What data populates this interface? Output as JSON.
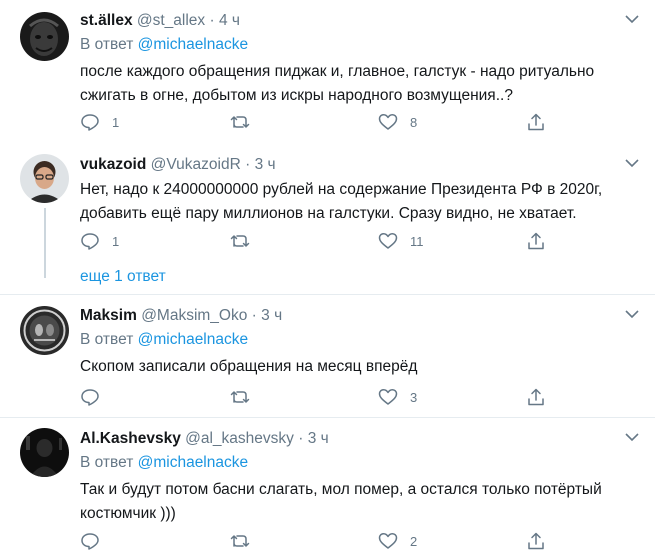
{
  "reply_prefix": "В ответ",
  "tweets": [
    {
      "name": "st.ällex",
      "handle": "@st_allex",
      "time": "4 ч",
      "reply_to": "@michaelnacke",
      "text": "после каждого обращения пиджак и, главное, галстук - надо ритуально сжигать в огне, добытом из искры народного возмущения..?",
      "replies": "1",
      "retweets": "",
      "likes": "8"
    },
    {
      "name": "vukazoid",
      "handle": "@VukazoidR",
      "time": "3 ч",
      "reply_to": "",
      "text": "Нет, надо к 24000000000 рублей на содержание Президента РФ в 2020г, добавить ещё пару миллионов на галстуки. Сразу видно, не хватает.",
      "replies": "1",
      "retweets": "",
      "likes": "11"
    },
    {
      "name": "Maksim",
      "handle": "@Maksim_Oko",
      "time": "3 ч",
      "reply_to": "@michaelnacke",
      "text": "Скопом записали обращения на месяц вперёд",
      "replies": "",
      "retweets": "",
      "likes": "3"
    },
    {
      "name": "Al.Kashevsky",
      "handle": "@al_kashevsky",
      "time": "3 ч",
      "reply_to": "@michaelnacke",
      "text": "Так и будут потом басни слагать, мол помер, а остался только потёртый костюмчик )))",
      "replies": "",
      "retweets": "",
      "likes": "2"
    }
  ],
  "more_replies": "еще 1 ответ",
  "icons": {
    "reply": "reply-icon",
    "retweet": "retweet-icon",
    "like": "like-icon",
    "share": "share-icon",
    "caret": "chevron-down-icon"
  },
  "colors": {
    "link": "#1b95e0",
    "muted": "#657786",
    "separator": "#e6ecf0"
  }
}
